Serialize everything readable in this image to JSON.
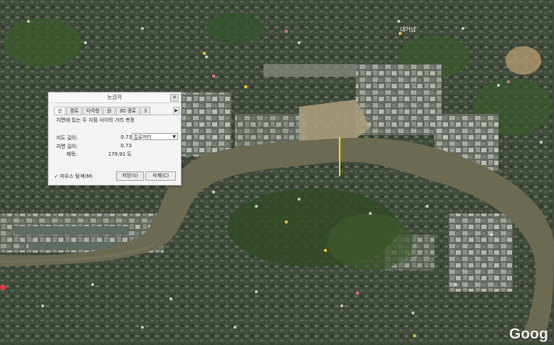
{
  "map": {
    "place_label": "대거넘",
    "watermark": "Goog",
    "measure_line_color": "#f2e21a"
  },
  "ruler": {
    "title": "눈금자",
    "close": "✕",
    "tabs": [
      "선",
      "경로",
      "다각형",
      "원",
      "3D 경로",
      "3"
    ],
    "active_tab": "선",
    "description": "지면에 있는 두 지점 사이의 거리 측정",
    "map_length_label": "지도 길이:",
    "map_length_value": "0.73",
    "ground_length_label": "지면 길이:",
    "ground_length_value": "0.73",
    "heading_label": "제목:",
    "heading_value": "179.91 도",
    "unit": "킬로미터",
    "mouse_nav": "✓ 마우스 탐색(M)",
    "save": "저장(S)",
    "clear": "삭제(C)"
  }
}
